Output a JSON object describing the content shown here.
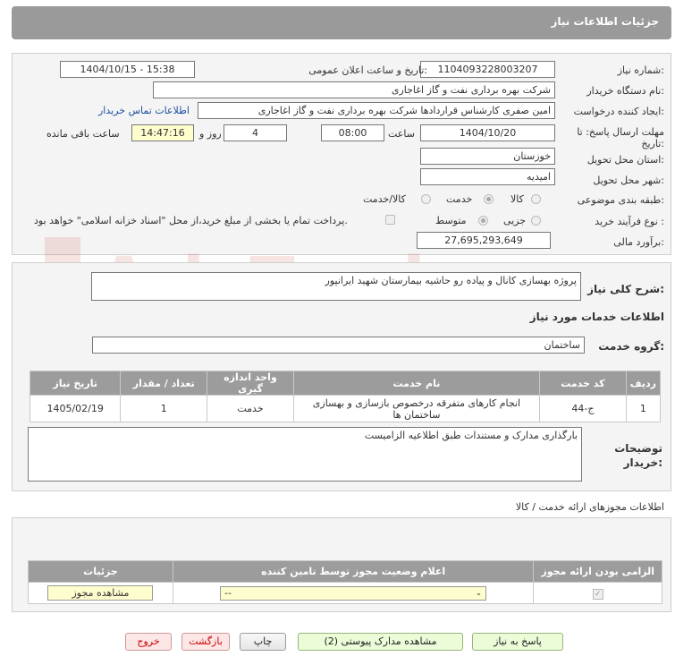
{
  "page": {
    "title": "جزئیات اطلاعات نیاز"
  },
  "watermark": {
    "text": "AriaTender.neT"
  },
  "form": {
    "need_number": {
      "label": "شماره نیاز:",
      "value": "1104093228003207"
    },
    "announce_datetime": {
      "label": "تاریخ و ساعت اعلان عمومی:",
      "value": "1404/10/15 - 15:38"
    },
    "buyer_org": {
      "label": "نام دستگاه خریدار:",
      "value": "شرکت بهره برداری نفت و گاز اغاجاری"
    },
    "requester": {
      "label": "ایجاد کننده درخواست:",
      "value": "امین صفری کارشناس قراردادها شرکت بهره برداری نفت و گاز اغاجاری"
    },
    "buyer_contact_link": "اطلاعات تماس خریدار",
    "deadline": {
      "label": "مهلت ارسال پاسخ: تا تاریخ:",
      "date": "1404/10/20",
      "time_label": "ساعت",
      "time": "08:00",
      "days": "4",
      "days_label": "روز و",
      "remaining": "14:47:16",
      "remaining_label": "ساعت باقی مانده"
    },
    "province": {
      "label": "استان محل تحویل:",
      "value": "خوزستان"
    },
    "city": {
      "label": "شهر محل تحویل:",
      "value": "امیدیه"
    },
    "category": {
      "label": "طبقه بندی موضوعی:",
      "options": [
        "کالا",
        "خدمت",
        "کالا/خدمت"
      ],
      "selected": "خدمت"
    },
    "process_type": {
      "label": "نوع فرآیند خرید :",
      "options": [
        "جزیی",
        "متوسط"
      ],
      "selected": "متوسط",
      "payment_note": "پرداخت تمام یا بخشی از مبلغ خرید،از محل \"اسناد خزانه اسلامی\" خواهد بود."
    },
    "estimate": {
      "label": "برآورد مالی:",
      "value": "27,695,293,649"
    }
  },
  "summary": {
    "label": "شرح کلی نیاز:",
    "value": "پروژه بهسازی کانال و پیاده رو حاشیه بیمارستان شهید ایرانپور"
  },
  "services": {
    "heading": "اطلاعات خدمات مورد نیاز",
    "group_label": "گروه خدمت:",
    "group_value": "ساختمان",
    "columns": [
      "ردیف",
      "کد خدمت",
      "نام خدمت",
      "واحد اندازه گیری",
      "تعداد / مقدار",
      "تاریخ نیاز"
    ],
    "rows": [
      [
        "1",
        "ج-44",
        "انجام کارهای متفرقه درخصوص بازسازی و بهسازی ساختمان ها",
        "خدمت",
        "1",
        "1405/02/19"
      ]
    ]
  },
  "buyer_notes": {
    "label": "توضیحات خریدار:",
    "value": "بارگذاری مدارک و مستندات طبق اطلاعیه الزامیست"
  },
  "permits": {
    "heading": "اطلاعات مجوزهای ارائه خدمت / کالا",
    "columns": [
      "الزامی بودن ارائه مجوز",
      "اعلام وضعیت مجوز توسط تامین کننده",
      "جزئیات"
    ],
    "select_value": "--",
    "view_button": "مشاهده مجوز"
  },
  "actions": {
    "reply": "پاسخ به نیاز",
    "attachments": "مشاهده مدارک پیوستی (2)",
    "print": "چاپ",
    "back": "بازگشت",
    "exit": "خروج"
  },
  "colors": {
    "header_gray": "#9a9a9a",
    "panel_bg": "#f4f4f4",
    "highlight": "#fefdce",
    "link": "#1c4fa0",
    "watermark_red": "#c0392b"
  }
}
